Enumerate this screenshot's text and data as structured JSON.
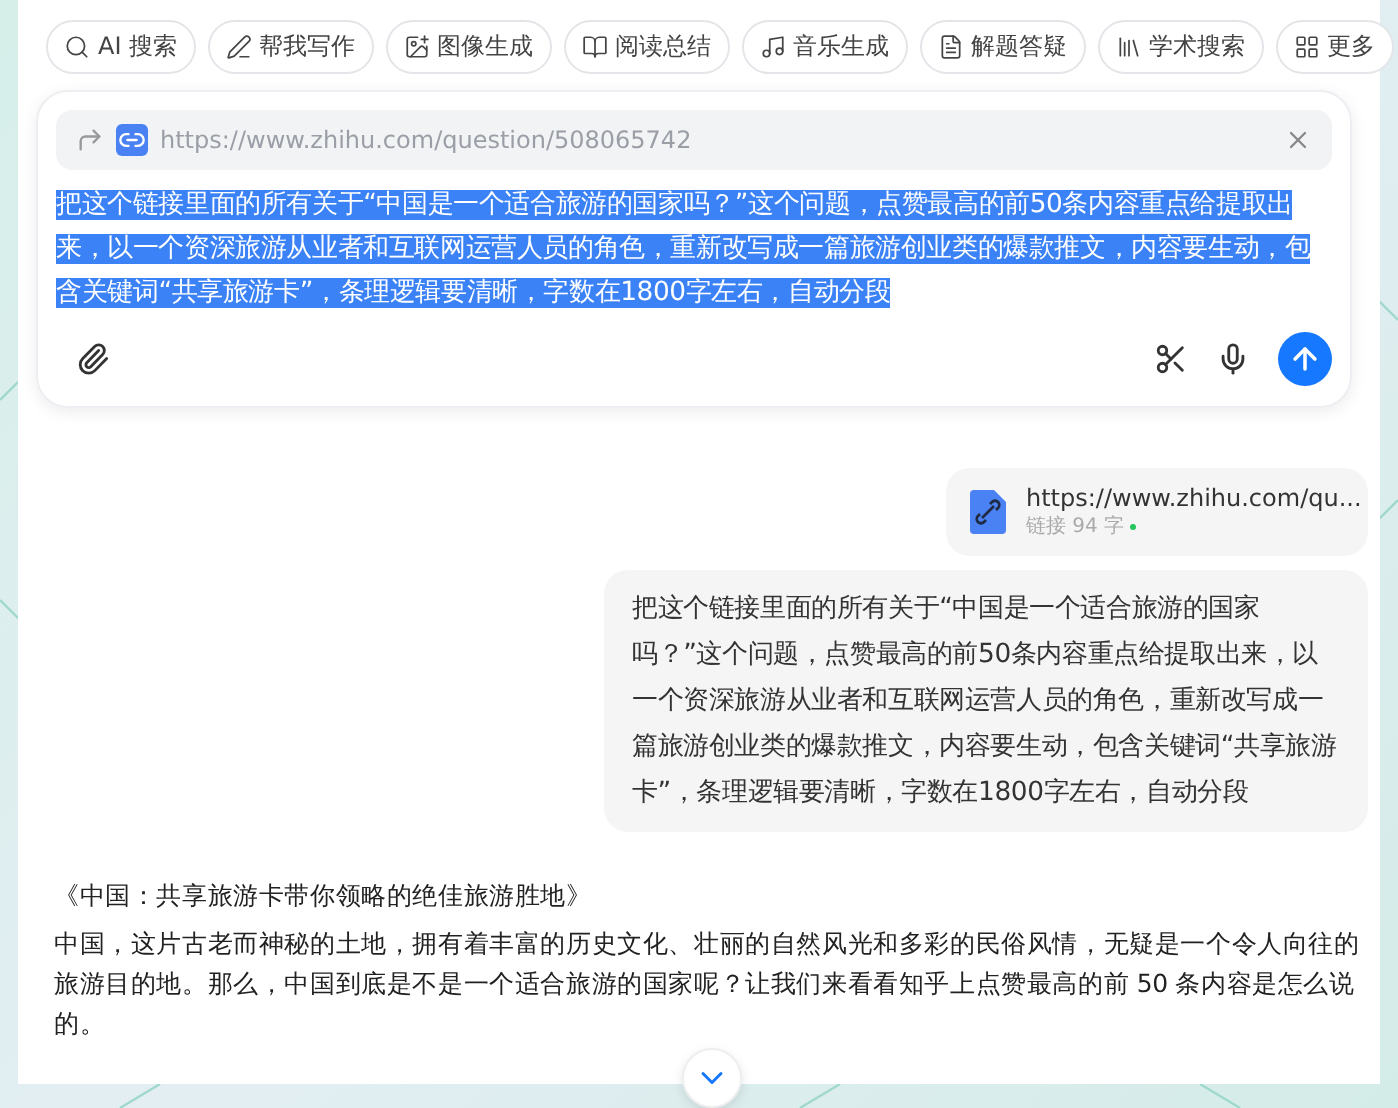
{
  "tools": [
    {
      "label": "AI 搜索",
      "kind": "search"
    },
    {
      "label": "帮我写作",
      "kind": "pen"
    },
    {
      "label": "图像生成",
      "kind": "image"
    },
    {
      "label": "阅读总结",
      "kind": "book"
    },
    {
      "label": "音乐生成",
      "kind": "music"
    },
    {
      "label": "解题答疑",
      "kind": "doc"
    },
    {
      "label": "学术搜索",
      "kind": "books"
    },
    {
      "label": "更多",
      "kind": "grid"
    }
  ],
  "composer": {
    "link": "https://www.zhihu.com/question/508065742",
    "prompt": "把这个链接里面的所有关于“中国是一个适合旅游的国家吗？”这个问题，点赞最高的前50条内容重点给提取出来，以一个资深旅游从业者和互联网运营人员的角色，重新改写成一篇旅游创业类的爆款推文，内容要生动，包含关键词“共享旅游卡”，条理逻辑要清晰，字数在1800字左右，自动分段",
    "prompt_selected": true
  },
  "attachment": {
    "title": "https://www.zhihu.com/qu...",
    "meta": "链接 94 字"
  },
  "user_message": "把这个链接里面的所有关于“中国是一个适合旅游的国家吗？”这个问题，点赞最高的前50条内容重点给提取出来，以一个资深旅游从业者和互联网运营人员的角色，重新改写成一篇旅游创业类的爆款推文，内容要生动，包含关键词“共享旅游卡”，条理逻辑要清晰，字数在1800字左右，自动分段",
  "answer": {
    "title": "《中国：共享旅游卡带你领略的绝佳旅游胜地》",
    "paragraph": "中国，这片古老而神秘的土地，拥有着丰富的历史文化、壮丽的自然风光和多彩的民俗风情，无疑是一个令人向往的旅游目的地。那么，中国到底是不是一个适合旅游的国家呢？让我们来看看知乎上点赞最高的前 50 条内容是怎么说的。"
  }
}
